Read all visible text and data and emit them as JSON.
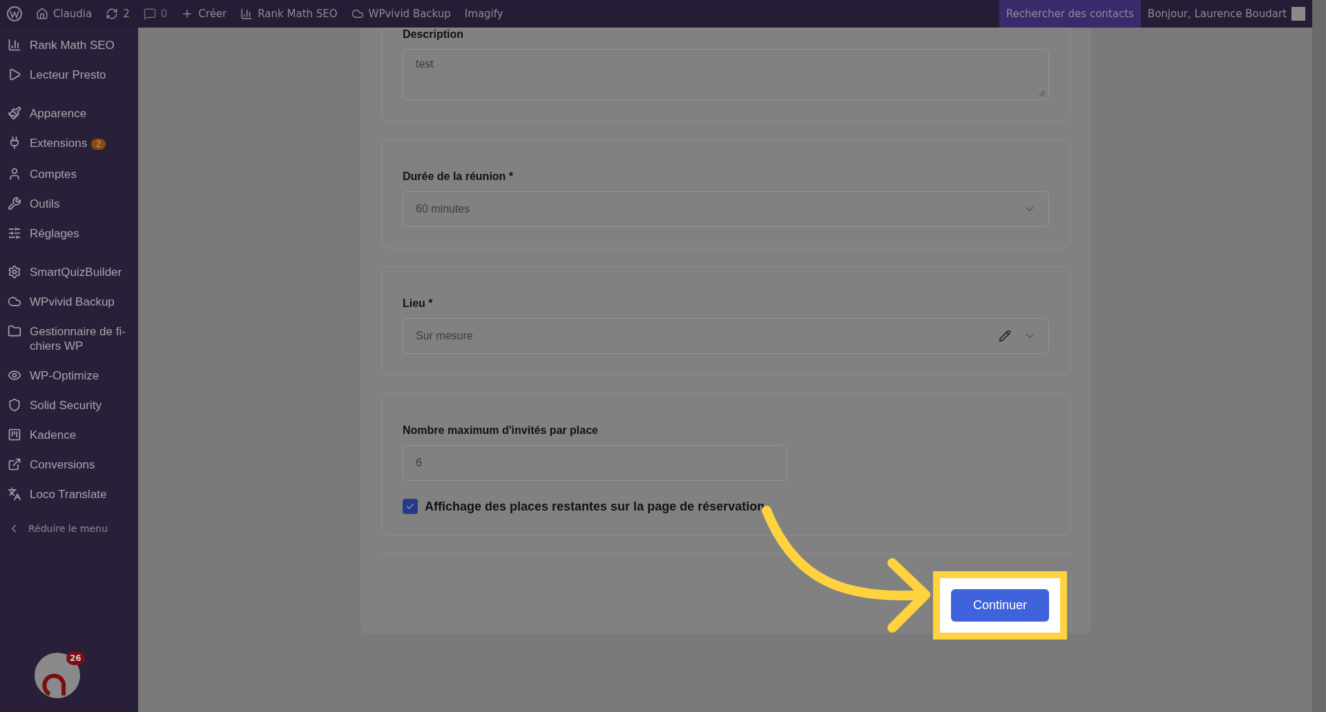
{
  "admin_bar": {
    "site": "Claudia",
    "updates": "2",
    "comments": "0",
    "new": "Créer",
    "items": [
      "Rank Math SEO",
      "WPvivid Backup",
      "Imagify"
    ],
    "search": "Rechercher des contacts",
    "greeting": "Bonjour, Laurence Boudart"
  },
  "sidebar": {
    "groups": [
      [
        "Rank Math SEO",
        "Lecteur Presto"
      ],
      [
        "Apparence",
        "Extensions",
        "Comptes",
        "Outils",
        "Réglages"
      ],
      [
        "SmartQuizBuilder",
        "WPvivid Backup",
        "Gestionnaire de fi- chiers WP",
        "WP-Optimize",
        "Solid Security",
        "Kadence",
        "Conversions",
        "Loco Translate"
      ]
    ],
    "badge": "2",
    "collapse": "Réduire le menu",
    "widget_badge": "26"
  },
  "form": {
    "description": {
      "label": "Description",
      "value": "test"
    },
    "duration": {
      "label": "Durée de la réunion *",
      "value": "60 minutes"
    },
    "location": {
      "label": "Lieu *",
      "value": "Sur mesure"
    },
    "max_guests": {
      "label": "Nombre maximum d'invités par place",
      "value": "6"
    },
    "show_remaining": {
      "label": "Affichage des places restantes sur la page de réservation",
      "checked": true
    },
    "submit": "Continuer"
  }
}
